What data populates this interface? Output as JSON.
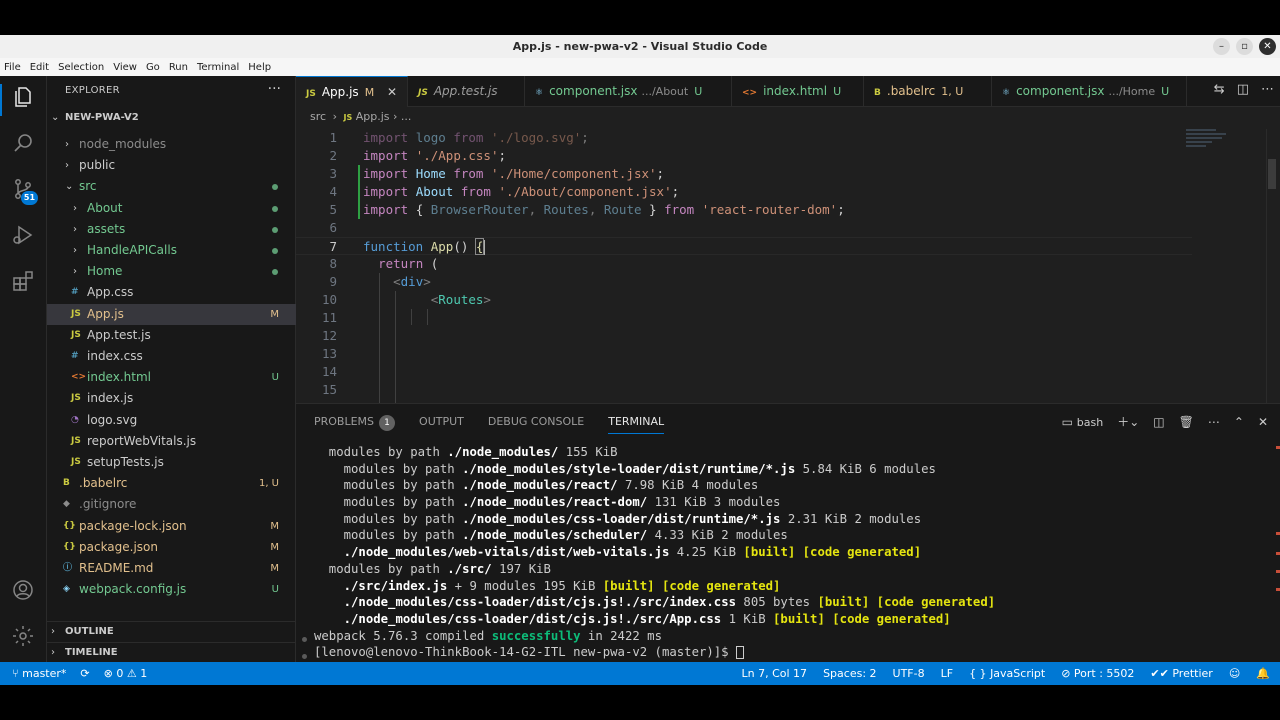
{
  "window": {
    "title": "App.js - new-pwa-v2 - Visual Studio Code",
    "controls": [
      "–",
      "▫",
      "✕"
    ]
  },
  "menu": [
    "File",
    "Edit",
    "Selection",
    "View",
    "Go",
    "Run",
    "Terminal",
    "Help"
  ],
  "activity_bar": {
    "scm_badge": "51",
    "icons": [
      "files-icon",
      "search-icon",
      "source-control-icon",
      "run-debug-icon",
      "extensions-icon",
      "accounts-icon",
      "settings-gear-icon"
    ]
  },
  "sidebar": {
    "title": "EXPLORER",
    "more": "···",
    "root": "NEW-PWA-V2",
    "tree": [
      {
        "name": "node_modules",
        "type": "folder",
        "depth": 1,
        "status": ""
      },
      {
        "name": "public",
        "type": "folder",
        "depth": 1,
        "status": ""
      },
      {
        "name": "src",
        "type": "folder-open",
        "depth": 1,
        "status": "dot"
      },
      {
        "name": "About",
        "type": "folder",
        "depth": 2,
        "status": "dot"
      },
      {
        "name": "assets",
        "type": "folder",
        "depth": 2,
        "status": "dot"
      },
      {
        "name": "HandleAPICalls",
        "type": "folder",
        "depth": 2,
        "status": "dot"
      },
      {
        "name": "Home",
        "type": "folder",
        "depth": 2,
        "status": "dot"
      },
      {
        "name": "App.css",
        "type": "css",
        "depth": 2,
        "status": ""
      },
      {
        "name": "App.js",
        "type": "js",
        "depth": 2,
        "status": "M"
      },
      {
        "name": "App.test.js",
        "type": "js",
        "depth": 2,
        "status": ""
      },
      {
        "name": "index.css",
        "type": "css",
        "depth": 2,
        "status": ""
      },
      {
        "name": "index.html",
        "type": "html",
        "depth": 2,
        "status": "U"
      },
      {
        "name": "index.js",
        "type": "js",
        "depth": 2,
        "status": ""
      },
      {
        "name": "logo.svg",
        "type": "svg",
        "depth": 2,
        "status": ""
      },
      {
        "name": "reportWebVitals.js",
        "type": "js",
        "depth": 2,
        "status": ""
      },
      {
        "name": "setupTests.js",
        "type": "js",
        "depth": 2,
        "status": ""
      },
      {
        "name": ".babelrc",
        "type": "babel",
        "depth": 1,
        "status": "1, U"
      },
      {
        "name": ".gitignore",
        "type": "git",
        "depth": 1,
        "status": ""
      },
      {
        "name": "package-lock.json",
        "type": "json",
        "depth": 1,
        "status": "M"
      },
      {
        "name": "package.json",
        "type": "json",
        "depth": 1,
        "status": "M"
      },
      {
        "name": "README.md",
        "type": "md",
        "depth": 1,
        "status": "M"
      },
      {
        "name": "webpack.config.js",
        "type": "webpack",
        "depth": 1,
        "status": "U"
      }
    ],
    "outline": "OUTLINE",
    "timeline": "TIMELINE"
  },
  "tabs": [
    {
      "icon": "JS",
      "label": "App.js",
      "desc": "",
      "status": "M",
      "active": true,
      "close": "✕"
    },
    {
      "icon": "JS",
      "label": "App.test.js",
      "desc": "",
      "status": "",
      "active": false
    },
    {
      "icon": "⚛",
      "label": "component.jsx",
      "desc": ".../About",
      "status": "U",
      "active": false
    },
    {
      "icon": "<>",
      "label": "index.html",
      "desc": "",
      "status": "U",
      "active": false
    },
    {
      "icon": "B",
      "label": ".babelrc",
      "desc": "",
      "status": "1, U",
      "active": false
    },
    {
      "icon": "⚛",
      "label": "component.jsx",
      "desc": ".../Home",
      "status": "U",
      "active": false
    }
  ],
  "breadcrumb": {
    "folder": "src",
    "sep": "›",
    "file": "App.js",
    "rest": "› ..."
  },
  "editor": {
    "line_numbers": [
      "1",
      "2",
      "3",
      "4",
      "5",
      "6",
      "7",
      "8",
      "9",
      "10",
      "11",
      "12",
      "13",
      "14",
      "15"
    ],
    "current_line": 7
  },
  "panel": {
    "tabs": [
      {
        "label": "PROBLEMS",
        "badge": "1",
        "active": false
      },
      {
        "label": "OUTPUT",
        "badge": "",
        "active": false
      },
      {
        "label": "DEBUG CONSOLE",
        "badge": "",
        "active": false
      },
      {
        "label": "TERMINAL",
        "badge": "",
        "active": true
      }
    ],
    "shell": "bash",
    "terminal_lines": [
      "  modules by path ./node_modules/ 155 KiB",
      "    modules by path ./node_modules/style-loader/dist/runtime/*.js 5.84 KiB 6 modules",
      "    modules by path ./node_modules/react/ 7.98 KiB 4 modules",
      "    modules by path ./node_modules/react-dom/ 131 KiB 3 modules",
      "    modules by path ./node_modules/css-loader/dist/runtime/*.js 2.31 KiB 2 modules",
      "    modules by path ./node_modules/scheduler/ 4.33 KiB 2 modules",
      "    ./node_modules/web-vitals/dist/web-vitals.js 4.25 KiB [built] [code generated]",
      "  modules by path ./src/ 197 KiB",
      "    ./src/index.js + 9 modules 195 KiB [built] [code generated]",
      "    ./node_modules/css-loader/dist/cjs.js!./src/index.css 805 bytes [built] [code generated]",
      "    ./node_modules/css-loader/dist/cjs.js!./src/App.css 1 KiB [built] [code generated]",
      "webpack 5.76.3 compiled successfully in 2422 ms",
      "[lenovo@lenovo-ThinkBook-14-G2-ITL new-pwa-v2 (master)]$ "
    ]
  },
  "status_bar": {
    "branch": "master*",
    "sync": "⟳",
    "errors": "0",
    "warnings": "1",
    "position": "Ln 7, Col 17",
    "spaces": "Spaces: 2",
    "encoding": "UTF-8",
    "eol": "LF",
    "language": "JavaScript",
    "port": "Port : 5502",
    "formatter": "Prettier"
  },
  "colors": {
    "accent": "#0078d4",
    "editor_bg": "#1f1f1f",
    "sidebar_bg": "#181818",
    "modified": "#e2c08d",
    "untracked": "#73c991"
  }
}
